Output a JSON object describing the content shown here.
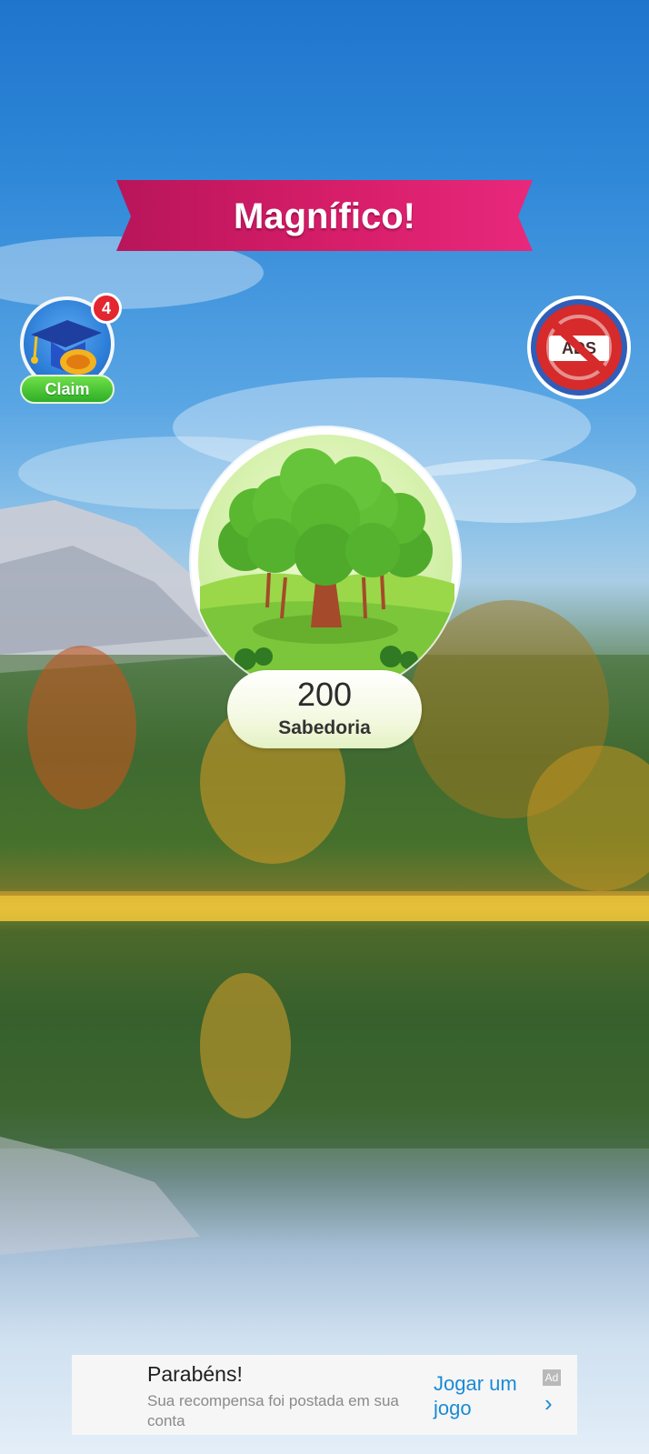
{
  "banner": {
    "title": "Magnífico!"
  },
  "claim": {
    "badge_count": "4",
    "button_label": "Claim"
  },
  "no_ads": {
    "label": "ADS"
  },
  "reward": {
    "value": "200",
    "label": "Sabedoria"
  },
  "ad": {
    "title": "Parabéns!",
    "description": "Sua recompensa foi postada em sua conta",
    "cta": "Jogar um jogo",
    "badge": "Ad",
    "chevron": "›"
  },
  "colors": {
    "banner": "#d81e6a",
    "claim_button": "#3dbf2c",
    "badge": "#e3262f",
    "ad_link": "#1a8bd6"
  }
}
